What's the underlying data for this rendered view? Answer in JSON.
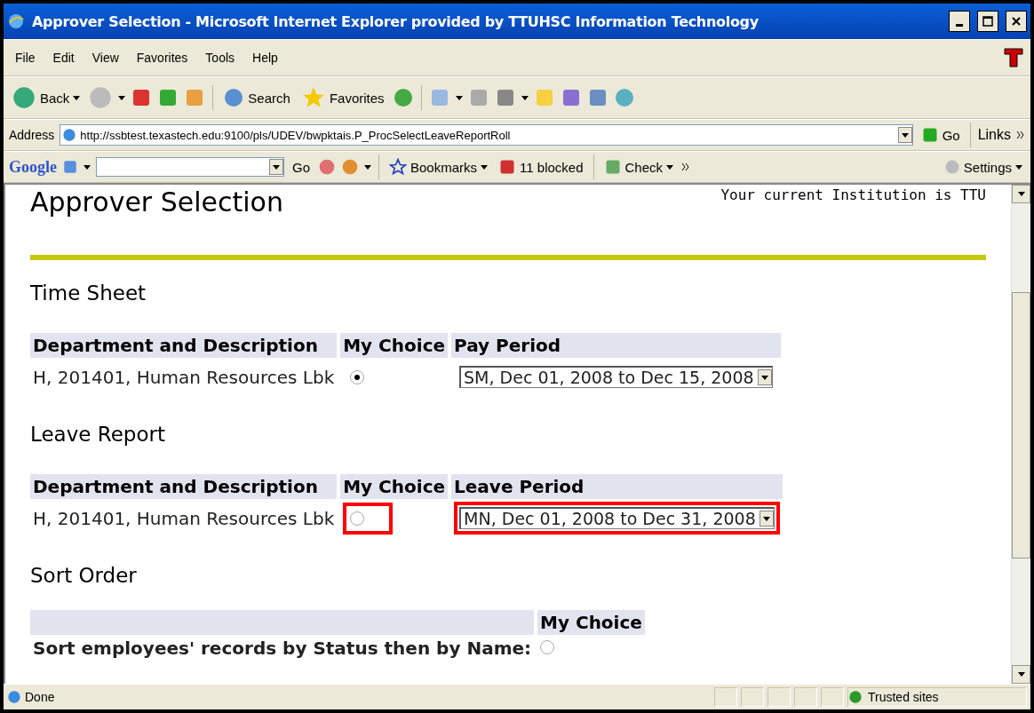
{
  "window": {
    "title": "Approver Selection - Microsoft Internet Explorer provided by TTUHSC Information Technology"
  },
  "menu": [
    "File",
    "Edit",
    "View",
    "Favorites",
    "Tools",
    "Help"
  ],
  "toolbar": {
    "back": "Back",
    "search": "Search",
    "favorites": "Favorites"
  },
  "address_bar": {
    "label": "Address",
    "url": "http://ssbtest.texastech.edu:9100/pls/UDEV/bwpktais.P_ProcSelectLeaveReportRoll",
    "go": "Go",
    "links": "Links"
  },
  "google_bar": {
    "logo": "Google",
    "go": "Go",
    "bookmarks": "Bookmarks",
    "blocked": "11 blocked",
    "check": "Check",
    "settings": "Settings"
  },
  "page": {
    "title": "Approver Selection",
    "institution": "Your current Institution is TTU",
    "sections": [
      {
        "heading": "Time Sheet",
        "columns": [
          "Department and Description",
          "My Choice",
          "Pay Period"
        ],
        "rows": [
          {
            "department": "H, 201401, Human Resources Lbk",
            "selected": true,
            "period": "SM, Dec 01, 2008 to Dec 15, 2008",
            "highlighted": false
          }
        ]
      },
      {
        "heading": "Leave Report",
        "columns": [
          "Department and Description",
          "My Choice",
          "Leave Period"
        ],
        "rows": [
          {
            "department": "H, 201401, Human Resources Lbk",
            "selected": false,
            "period": "MN, Dec 01, 2008 to Dec 31, 2008",
            "highlighted": true
          }
        ]
      }
    ],
    "sort": {
      "heading": "Sort Order",
      "column": "My Choice",
      "rows": [
        {
          "label": "Sort employees' records by Status then by Name:",
          "selected": false
        }
      ]
    }
  },
  "status_bar": {
    "text": "Done",
    "zone": "Trusted sites"
  }
}
